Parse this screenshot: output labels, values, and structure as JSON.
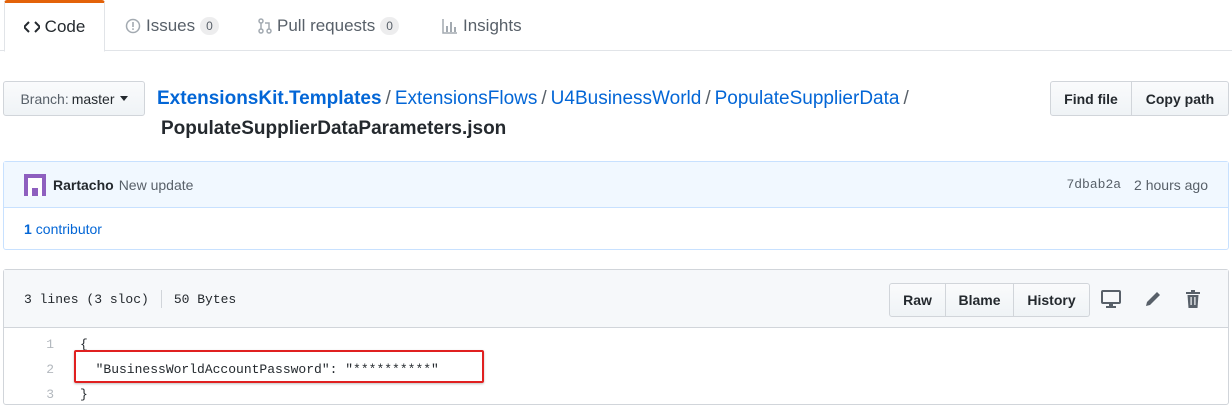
{
  "tabs": [
    {
      "label": "Code",
      "icon": "code-icon",
      "active": true
    },
    {
      "label": "Issues",
      "icon": "issue-icon",
      "count": "0"
    },
    {
      "label": "Pull requests",
      "icon": "pull-request-icon",
      "count": "0"
    },
    {
      "label": "Insights",
      "icon": "graph-icon"
    }
  ],
  "branch": {
    "prefix": "Branch:",
    "name": "master"
  },
  "breadcrumb": {
    "root": "ExtensionsKit.Templates",
    "parts": [
      "ExtensionsFlows",
      "U4BusinessWorld",
      "PopulateSupplierData"
    ],
    "separator": "/",
    "file": "PopulateSupplierDataParameters.json"
  },
  "actions": {
    "find_file": "Find file",
    "copy_path": "Copy path"
  },
  "commit": {
    "author": "Rartacho",
    "message": "New update",
    "sha": "7dbab2a",
    "time": "2 hours ago",
    "contributors_count": "1",
    "contributors_label": "contributor"
  },
  "file": {
    "lines_info": "3 lines (3 sloc)",
    "size": "50 Bytes",
    "raw": "Raw",
    "blame": "Blame",
    "history": "History",
    "code": [
      {
        "num": "1",
        "text": "{"
      },
      {
        "num": "2",
        "text": "  \"BusinessWorldAccountPassword\": \"**********\""
      },
      {
        "num": "3",
        "text": "}"
      }
    ]
  },
  "colors": {
    "accent_tab": "#e36209",
    "link": "#0366d6",
    "highlight": "#e02020",
    "avatar": "#8e5fbf"
  }
}
